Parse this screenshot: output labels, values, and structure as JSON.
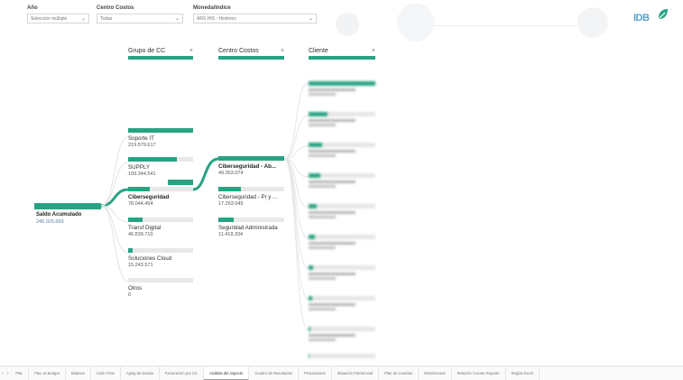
{
  "filters": [
    {
      "label": "Año",
      "value": "Selección múltiple"
    },
    {
      "label": "Centro Costos",
      "value": "Todas"
    },
    {
      "label": "Moneda/Indice",
      "value": "ARS HIS - Histórico"
    }
  ],
  "logo": {
    "text": "IDB"
  },
  "tree": {
    "headers": [
      {
        "label": "Grupo de CC",
        "close": "×"
      },
      {
        "label": "Centro Costos",
        "close": "×"
      },
      {
        "label": "Cliente",
        "close": "×"
      }
    ],
    "root": {
      "label": "Saldo Acumulado",
      "value": "245.025.693"
    },
    "level1": [
      {
        "label": "Soporte IT",
        "value": "219.579.617",
        "fill": 1.0
      },
      {
        "label": "SUPPLY",
        "value": "109.344.541",
        "fill": 0.75
      },
      {
        "label": "Ciberseguridad",
        "value": "78.044.454",
        "fill": 0.34
      },
      {
        "label": "Transf Digital",
        "value": "46.839.710",
        "fill": 0.22
      },
      {
        "label": "Soluciones Cloud",
        "value": "15.243.571",
        "fill": 0.07
      },
      {
        "label": "Otros",
        "value": "0",
        "fill": 0
      }
    ],
    "level2": [
      {
        "label": "Ciberseguridad - Ab...",
        "value": "49.363.074",
        "fill": 1.0
      },
      {
        "label": "Ciberseguridad - Pr y ...",
        "value": "17.263.045",
        "fill": 0.34
      },
      {
        "label": "Seguridad Administrada",
        "value": "11.418.334",
        "fill": 0.23
      }
    ]
  },
  "tabs": {
    "nav": [
      "‹",
      "›"
    ],
    "items": [
      "P&L",
      "P&L vs Budget",
      "Balance",
      "Cash Flow",
      "Aging de Deuda",
      "Facturación por CC",
      "Análisis del Aspecto",
      "Cuadro de Resultados",
      "Proveedores",
      "Situación Patrimonial",
      "Plan de Cuentas",
      "Movimientos",
      "Relación Cuenta Reporte",
      "Reglas Excel"
    ],
    "active": 6
  },
  "colors": {
    "accent": "#27a383",
    "track": "#e8e8e8",
    "logo": "#5aa1c9"
  }
}
